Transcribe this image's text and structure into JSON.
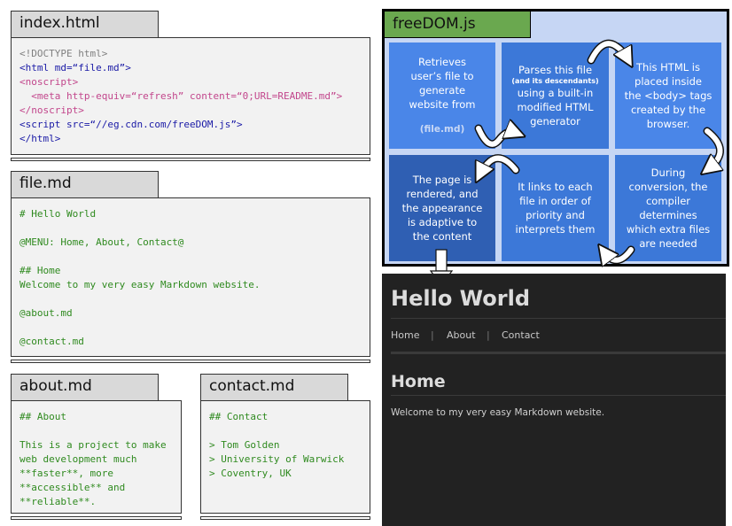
{
  "panels": {
    "index": {
      "tab": "index.html",
      "lines": [
        "<!DOCTYPE html>",
        "<html md=“file.md”>",
        "<noscript>",
        "  <meta http-equiv=“refresh” content=“0;URL=README.md”>",
        "</noscript>",
        "<script src=“//eg.cdn.com/freeDOM.js”>",
        "</html>"
      ]
    },
    "file": {
      "tab": "file.md",
      "lines": [
        "# Hello World",
        "",
        "@MENU: Home, About, Contact@",
        "",
        "## Home",
        "Welcome to my very easy Markdown website.",
        "",
        "@about.md",
        "",
        "@contact.md"
      ]
    },
    "about": {
      "tab": "about.md",
      "lines": [
        "## About",
        "",
        "This is a project to make",
        "web development much",
        "**faster**, more",
        "**accessible** and",
        "**reliable**."
      ]
    },
    "contact": {
      "tab": "contact.md",
      "lines": [
        "## Contact",
        "",
        "> Tom Golden",
        "> University of Warwick",
        "> Coventry, UK"
      ]
    }
  },
  "freedom": {
    "title": "freeDOM.js",
    "steps": {
      "s1": {
        "line1": "Retrieves",
        "line2": "user’s file to",
        "line3": "generate",
        "line4": "website from",
        "note": "(file.md)"
      },
      "s2": {
        "line1": "Parses this file",
        "small": "(and its descendants)",
        "line3": "using a built-in",
        "line4": "modified HTML",
        "line5": "generator"
      },
      "s3": {
        "line1": "This HTML is",
        "line2": "placed inside",
        "line3": "the <body> tags",
        "line4": "created by the",
        "line5": "browser."
      },
      "s4": {
        "line1": "During",
        "line2": "conversion, the",
        "line3": "compiler",
        "line4": "determines",
        "line5": "which extra files",
        "line6": "are needed"
      },
      "s5": {
        "line1": "It links to each",
        "line2": "file in order of",
        "line3": "priority and",
        "line4": "interprets them"
      },
      "s6": {
        "line1": "The page is",
        "line2": "rendered, and",
        "line3": "the appearance",
        "line4": "is adaptive to",
        "line5": "the content"
      }
    },
    "colors": {
      "frame_bg": "#c6d6f4",
      "title_bg": "#6aa84f",
      "box_light": "#4a86e8",
      "box_mid": "#3c78d8",
      "box_dark": "#2f5fb3"
    }
  },
  "website": {
    "title": "Hello World",
    "nav": [
      "Home",
      "About",
      "Contact"
    ],
    "nav_separator": "|",
    "heading": "Home",
    "body": "Welcome to my very easy Markdown website."
  }
}
